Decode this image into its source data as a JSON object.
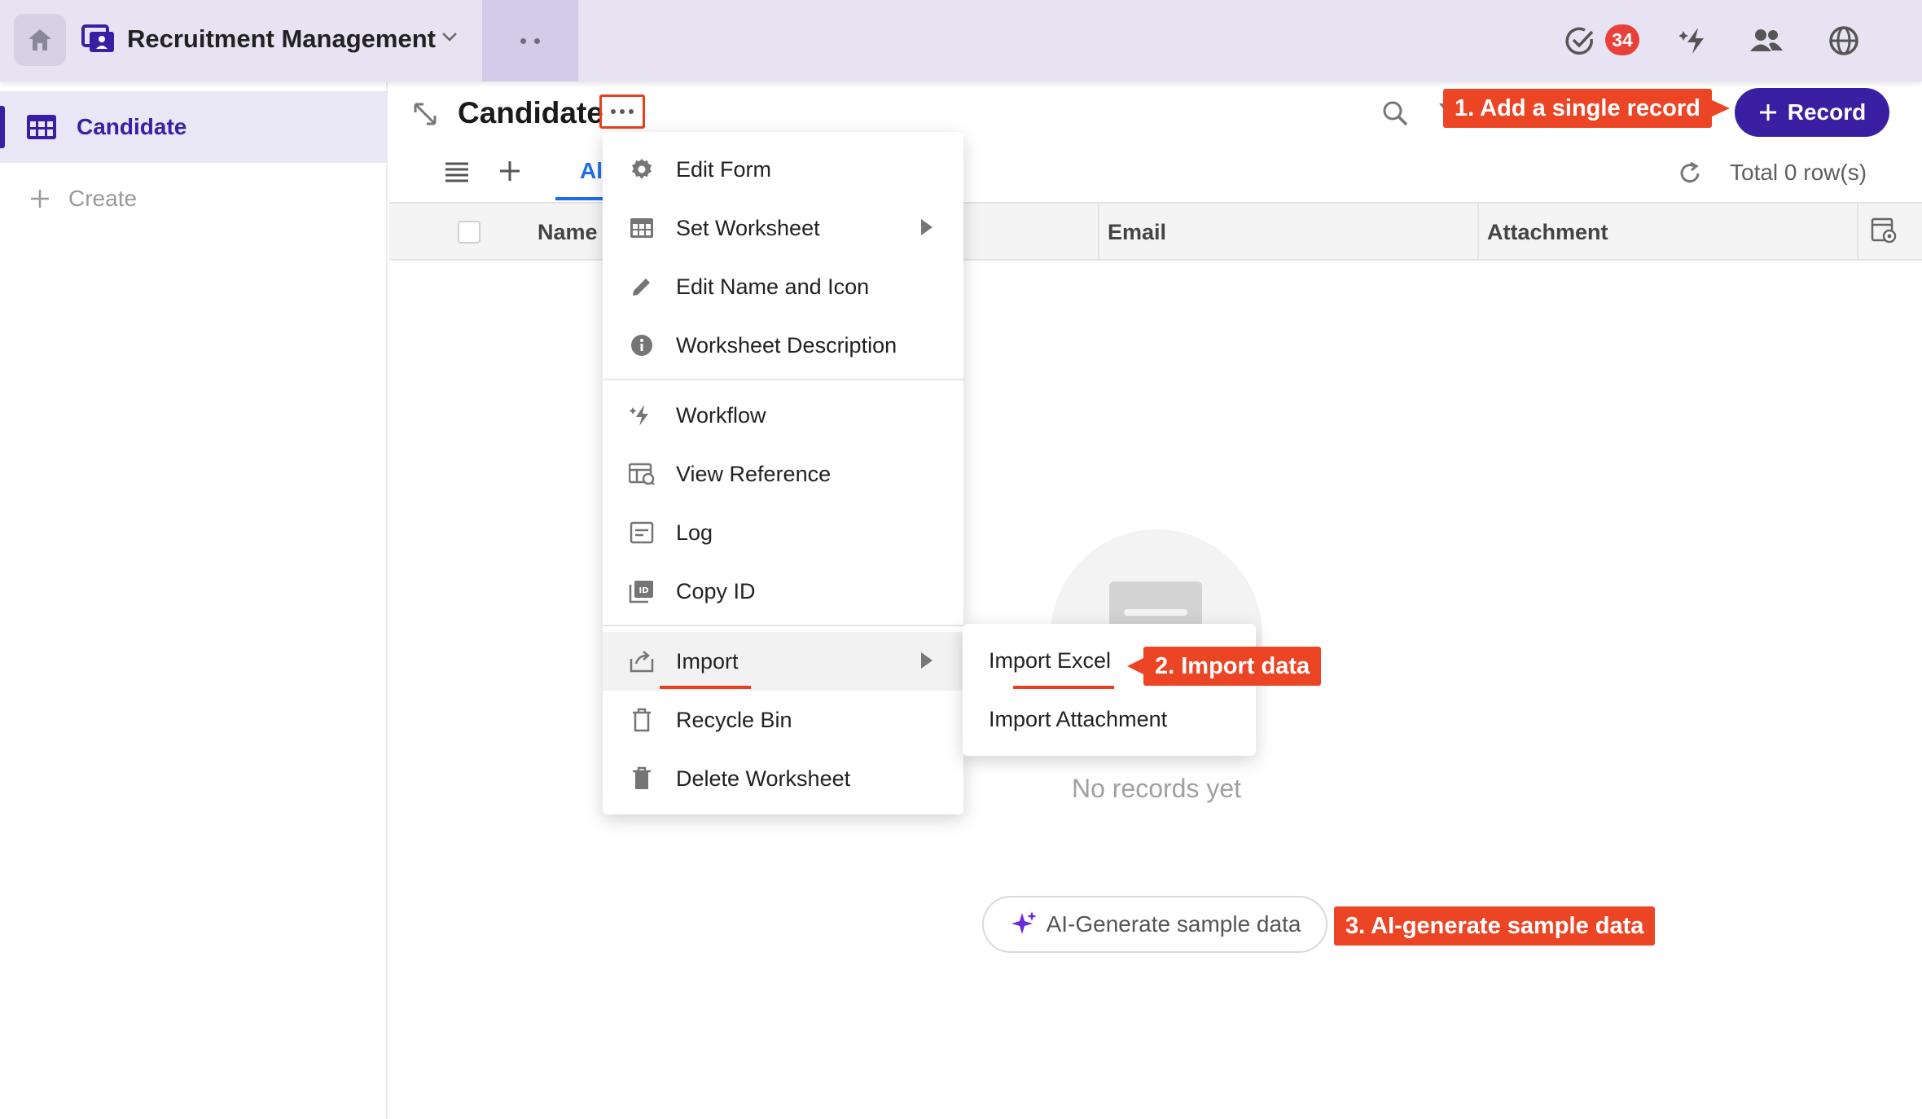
{
  "app": {
    "title": "Recruitment Management",
    "notification_count": "34"
  },
  "sidebar": {
    "items": [
      {
        "label": "Candidate"
      }
    ],
    "create_label": "Create"
  },
  "sheet": {
    "title": "Candidate",
    "record_button": "Record",
    "total_rows": "Total 0 row(s)"
  },
  "views": {
    "tabs": [
      {
        "label": "All"
      }
    ]
  },
  "table": {
    "columns": [
      "Name",
      "Email",
      "Attachment"
    ]
  },
  "menu": {
    "items": [
      {
        "label": "Edit Form",
        "icon": "gear-icon"
      },
      {
        "label": "Set Worksheet",
        "icon": "grid-icon",
        "submenu": true
      },
      {
        "label": "Edit Name and Icon",
        "icon": "pencil-icon"
      },
      {
        "label": "Worksheet Description",
        "icon": "info-icon"
      },
      {
        "label": "Workflow",
        "icon": "lightning-icon"
      },
      {
        "label": "View Reference",
        "icon": "reference-icon"
      },
      {
        "label": "Log",
        "icon": "log-icon"
      },
      {
        "label": "Copy ID",
        "icon": "copy-id-icon"
      },
      {
        "label": "Import",
        "icon": "import-icon",
        "submenu": true
      },
      {
        "label": "Recycle Bin",
        "icon": "trash-outline-icon"
      },
      {
        "label": "Delete Worksheet",
        "icon": "trash-icon"
      }
    ]
  },
  "import_submenu": {
    "items": [
      {
        "label": "Import Excel"
      },
      {
        "label": "Import Attachment"
      }
    ]
  },
  "empty_state": {
    "message": "No records yet",
    "ai_button": "AI-Generate sample data"
  },
  "annotations": {
    "step1": "1. Add a single record",
    "step2": "2. Import data",
    "step3": "3. AI-generate sample data"
  },
  "colors": {
    "brand": "#3a1fa3",
    "accent": "#1e6fe6",
    "annotation": "#ec4526",
    "badge": "#e8413a"
  }
}
